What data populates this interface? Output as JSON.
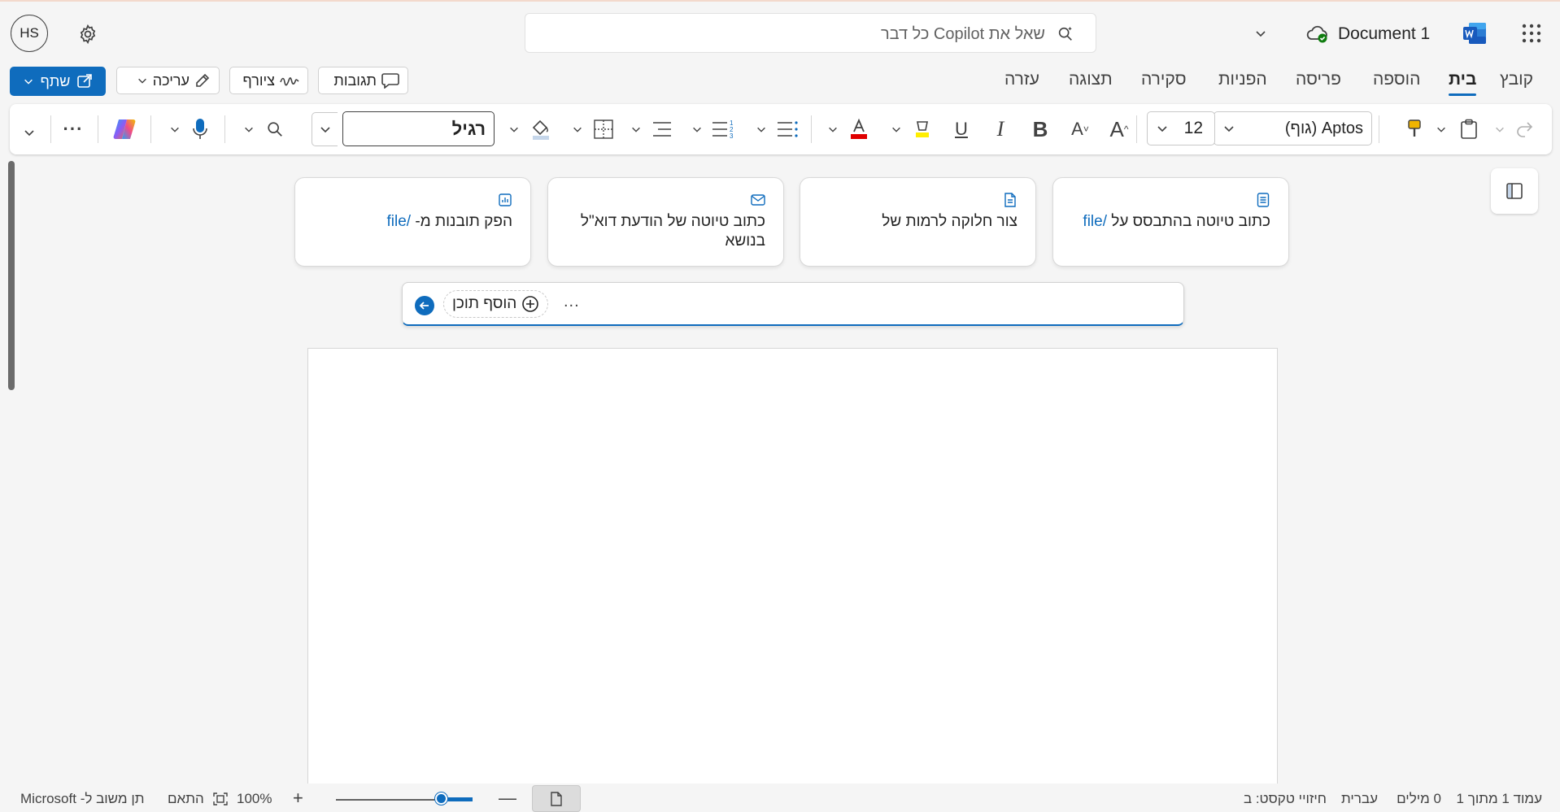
{
  "header": {
    "user_initials": "HS",
    "search_placeholder": "שאל את Copilot כל דבר",
    "doc_title": "Document 1"
  },
  "menu": {
    "tabs": [
      "קובץ",
      "בית",
      "הוספה",
      "פריסה",
      "הפניות",
      "סקירה",
      "תצוגה",
      "עזרה"
    ],
    "active_tab": "בית",
    "comments_label": "תגובות",
    "draw_label": "ציורף",
    "edit_label": "עריכה",
    "share_label": "שתף"
  },
  "ribbon": {
    "font_name": "Aptos (גוף)",
    "font_size": "12",
    "style_value": "רגיל",
    "font_color": "#e00000",
    "highlight_color": "#ffee00"
  },
  "copilot": {
    "cards": [
      {
        "text": "כתוב טיוטה בהתבסס על",
        "slash": "/file",
        "icon": "document-lines-icon"
      },
      {
        "text": "צור חלוקה לרמות של",
        "slash": "",
        "icon": "document-icon"
      },
      {
        "text": "כתוב טיוטה של הודעת דוא\"ל בנושא",
        "slash": "",
        "icon": "mail-icon"
      },
      {
        "text": "הפק תובנות מ-",
        "slash": "/file",
        "icon": "chart-icon"
      }
    ],
    "add_content_label": "הוסף תוכן",
    "more_label": "..."
  },
  "status": {
    "page_info": "עמוד 1 מתוך 1",
    "words": "0 מילים",
    "language": "עברית",
    "text_predictions": "חיזויי טקסט: ב",
    "zoom": "100%",
    "fit_label": "התאם",
    "feedback_label": "תן משוב ל- Microsoft",
    "zoom_level": 100
  },
  "colors": {
    "accent": "#0f6cbd"
  }
}
